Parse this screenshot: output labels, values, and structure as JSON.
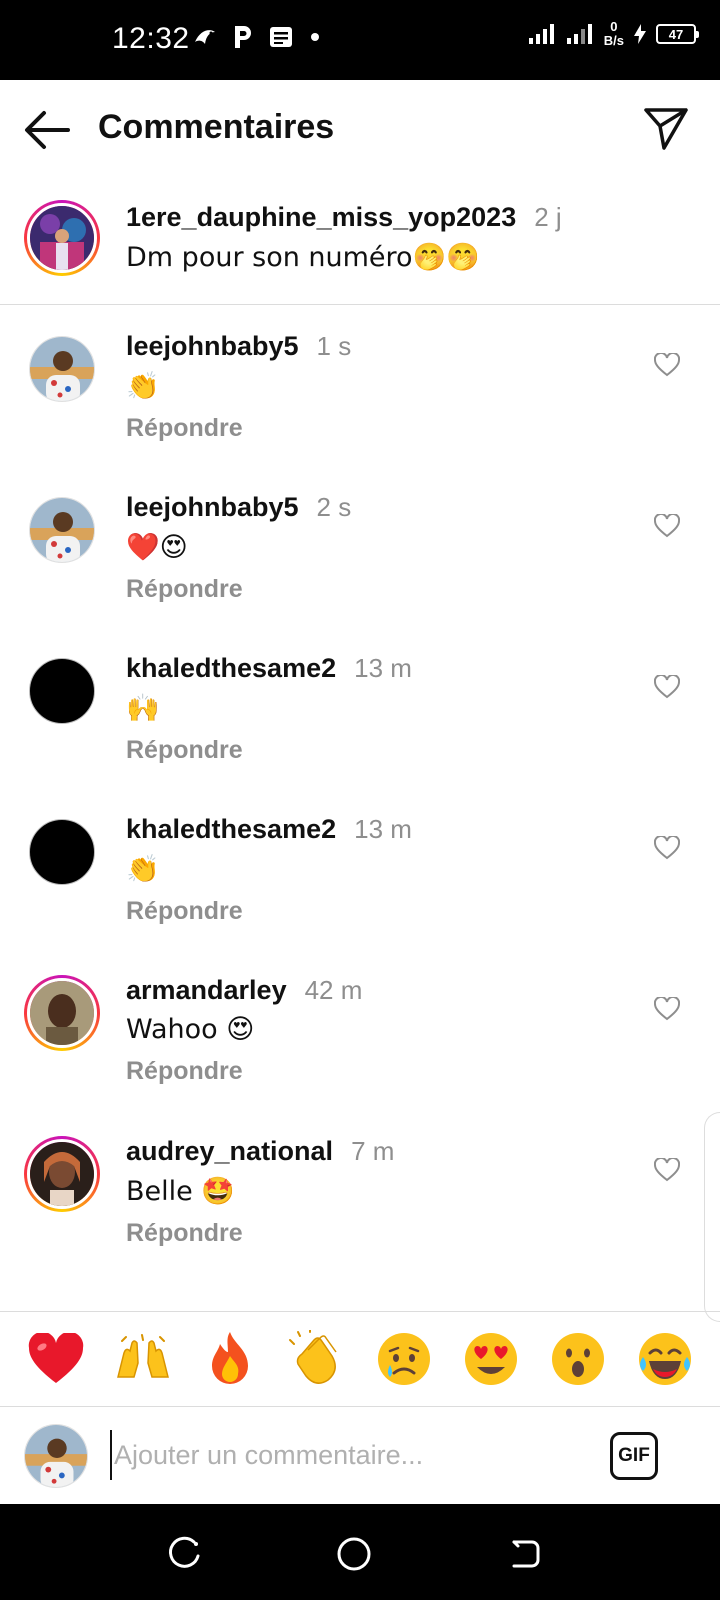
{
  "status_bar": {
    "time": "12:32",
    "net_value": "0",
    "net_unit": "B/s",
    "battery": "47"
  },
  "header": {
    "title": "Commentaires"
  },
  "caption": {
    "username": "1ere_dauphine_miss_yop2023",
    "time": "2 j",
    "text": "Dm pour son numéro🤭🤭"
  },
  "comments": [
    {
      "username": "leejohnbaby5",
      "time": "1 s",
      "text": "👏",
      "reply": "Répondre"
    },
    {
      "username": "leejohnbaby5",
      "time": "2 s",
      "text": "❤️😍",
      "reply": "Répondre"
    },
    {
      "username": "khaledthesame2",
      "time": "13 m",
      "text": "🙌",
      "reply": "Répondre"
    },
    {
      "username": "khaledthesame2",
      "time": "13 m",
      "text": "👏",
      "reply": "Répondre"
    },
    {
      "username": "armandarley",
      "time": "42 m",
      "text": "Wahoo 😍",
      "reply": "Répondre"
    },
    {
      "username": "audrey_national",
      "time": "7 m",
      "text": "Belle 🤩",
      "reply": "Répondre"
    }
  ],
  "emoji_bar": [
    "❤️",
    "🙌",
    "🔥",
    "👏",
    "😢",
    "😍",
    "😮",
    "😂"
  ],
  "input": {
    "placeholder": "Ajouter un commentaire...",
    "gif_label": "GIF"
  },
  "colors": {
    "ring_start": "#c913b9",
    "ring_mid": "#f9373f",
    "ring_end": "#fecd00",
    "muted_text": "#8e8e8e"
  }
}
